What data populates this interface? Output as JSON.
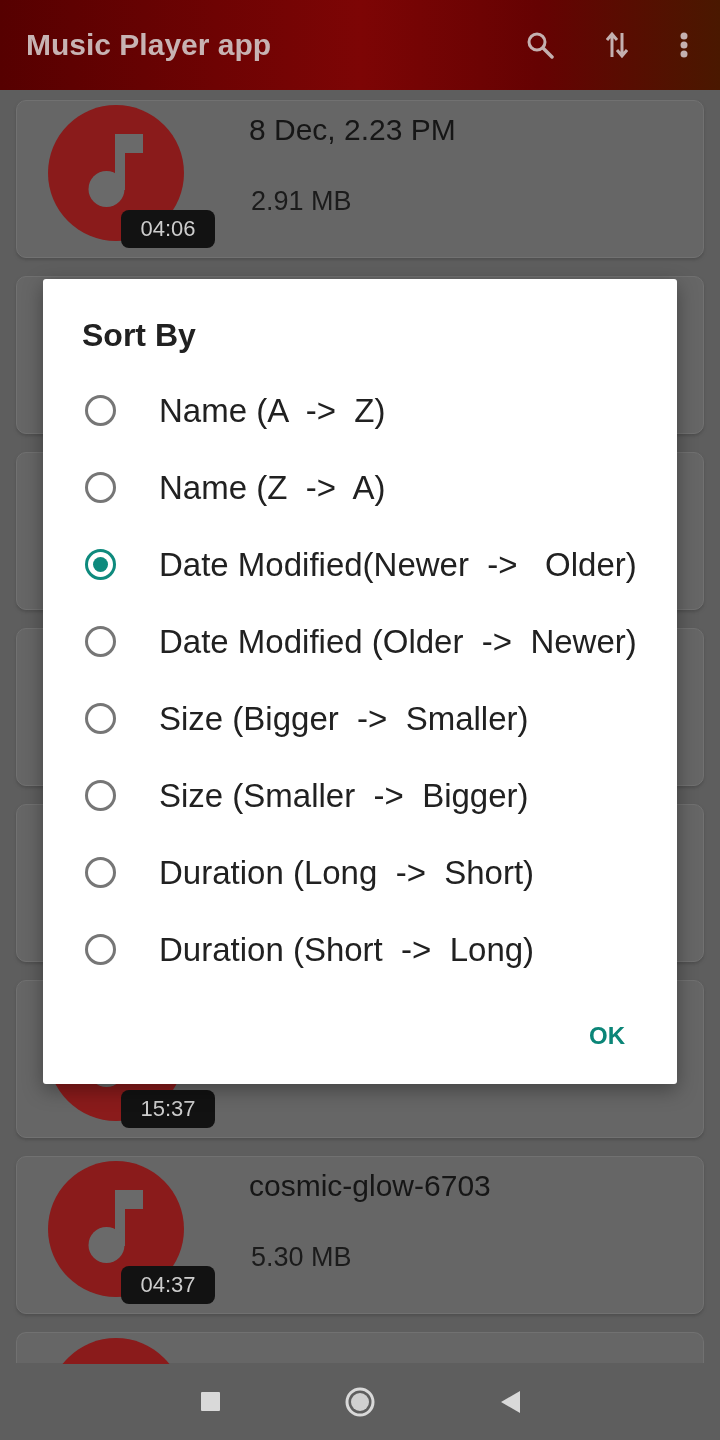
{
  "app_bar": {
    "title": "Music Player app"
  },
  "songs": [
    {
      "kind": "full",
      "title": "8 Dec, 2.23 PM",
      "size": "2.91 MB",
      "duration": "04:06"
    },
    {
      "kind": "covered"
    },
    {
      "kind": "covered"
    },
    {
      "kind": "covered"
    },
    {
      "kind": "covered"
    },
    {
      "kind": "badge_only",
      "duration": "15:37"
    },
    {
      "kind": "full",
      "title": "cosmic-glow-6703",
      "size": "5.30 MB",
      "duration": "04:37"
    },
    {
      "kind": "cut"
    }
  ],
  "dialog": {
    "title": "Sort By",
    "options": [
      {
        "label": "Name (A  ->  Z)",
        "selected": false
      },
      {
        "label": "Name (Z  ->  A)",
        "selected": false
      },
      {
        "label": "Date Modified(Newer  ->   Older)",
        "selected": true
      },
      {
        "label": "Date Modified (Older  ->  Newer)",
        "selected": false
      },
      {
        "label": "Size (Bigger  ->  Smaller)",
        "selected": false
      },
      {
        "label": "Size (Smaller  ->  Bigger)",
        "selected": false
      },
      {
        "label": "Duration (Long  ->  Short)",
        "selected": false
      },
      {
        "label": "Duration (Short  ->  Long)",
        "selected": false
      }
    ],
    "button": "OK"
  }
}
